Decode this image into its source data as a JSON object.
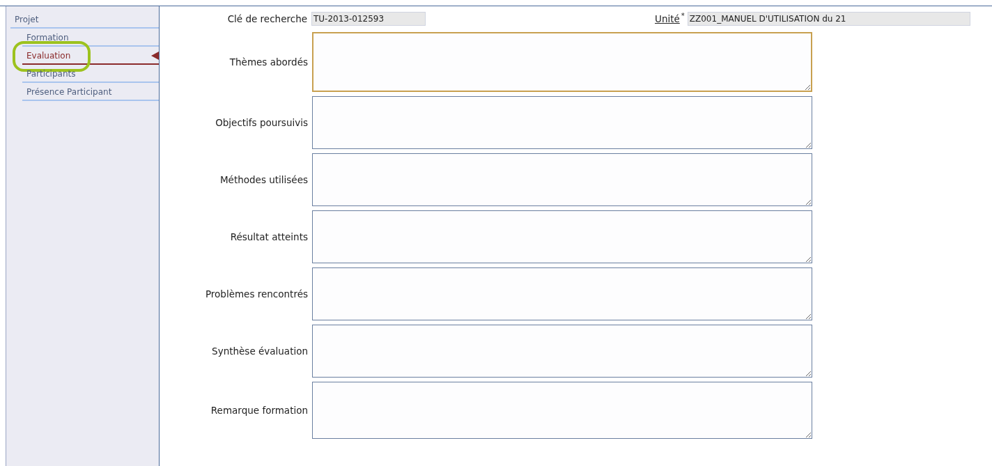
{
  "sidebar": {
    "items": [
      {
        "label": "Projet",
        "selected": false,
        "highlighted": false,
        "children": [
          {
            "label": "Formation",
            "selected": false,
            "highlighted": false
          },
          {
            "label": "Evaluation",
            "selected": true,
            "highlighted": true
          },
          {
            "label": "Participants",
            "selected": false,
            "highlighted": false
          },
          {
            "label": "Présence Participant",
            "selected": false,
            "highlighted": false
          }
        ]
      }
    ]
  },
  "header_fields": [
    {
      "label": "Clé de recherche",
      "kind": "plain",
      "value": "TU-2013-012593"
    },
    {
      "label": "Unité",
      "kind": "link",
      "required_mark": "*",
      "value": "ZZ001_MANUEL D'UTILISATION du 21"
    }
  ],
  "text_areas": [
    {
      "label": "Thèmes abordés",
      "focused": true
    },
    {
      "label": "Objectifs poursuivis",
      "focused": false
    },
    {
      "label": "Méthodes utilisées",
      "focused": false
    },
    {
      "label": "Résultat atteints",
      "focused": false
    },
    {
      "label": "Problèmes rencontrés",
      "focused": false
    },
    {
      "label": "Synthèse évaluation",
      "focused": false
    },
    {
      "label": "Remarque formation",
      "focused": false
    }
  ]
}
